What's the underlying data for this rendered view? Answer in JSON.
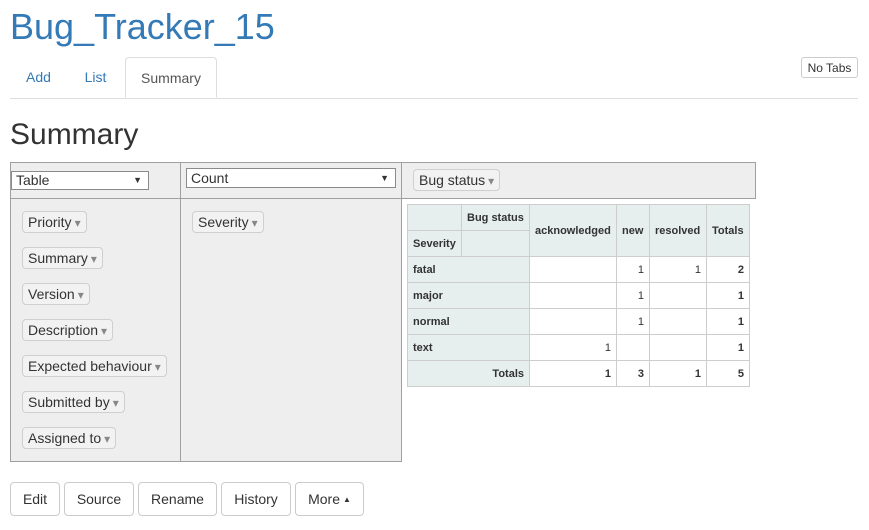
{
  "app": {
    "title": "Bug_Tracker_15"
  },
  "tabs": [
    {
      "label": "Add"
    },
    {
      "label": "List"
    },
    {
      "label": "Summary"
    }
  ],
  "no_tabs_label": "No Tabs",
  "page": {
    "title": "Summary"
  },
  "pivot": {
    "renderer": {
      "value": "Table",
      "options": [
        "Table"
      ]
    },
    "aggregator": {
      "value": "Count",
      "options": [
        "Count"
      ]
    },
    "column_attributes": [
      "Bug status"
    ],
    "row_attributes": [
      "Severity"
    ],
    "unused_attributes": [
      "Priority",
      "Summary",
      "Version",
      "Description",
      "Expected behaviour",
      "Submitted by",
      "Assigned to"
    ],
    "dropdown_icon": "▾"
  },
  "pivot_table": {
    "col_header_label": "Bug status",
    "row_header_label": "Severity",
    "columns": [
      "acknowledged",
      "new",
      "resolved"
    ],
    "totals_label": "Totals",
    "rows": [
      {
        "label": "fatal",
        "values": [
          "",
          "1",
          "1"
        ],
        "total": "2"
      },
      {
        "label": "major",
        "values": [
          "",
          "1",
          ""
        ],
        "total": "1"
      },
      {
        "label": "normal",
        "values": [
          "",
          "1",
          ""
        ],
        "total": "1"
      },
      {
        "label": "text",
        "values": [
          "1",
          "",
          ""
        ],
        "total": "1"
      }
    ],
    "column_totals": [
      "1",
      "3",
      "1"
    ],
    "grand_total": "5"
  },
  "actions": [
    {
      "label": "Edit"
    },
    {
      "label": "Source"
    },
    {
      "label": "Rename"
    },
    {
      "label": "History"
    },
    {
      "label": "More"
    }
  ],
  "colors": {
    "link": "#337ab7",
    "table_header": "#e6eeee",
    "panel": "#eeeeee"
  }
}
